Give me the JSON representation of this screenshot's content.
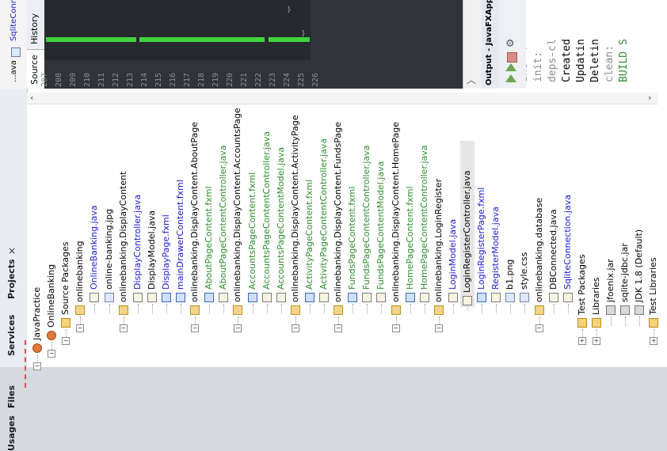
{
  "editor": {
    "tabs": [
      "History",
      "Source"
    ],
    "file_tab": "SqliteConn",
    "side_label": "...ava",
    "line_numbers": [
      "207",
      "208",
      "209",
      "210",
      "211",
      "212",
      "213",
      "214",
      "215",
      "216",
      "217",
      "218",
      "219",
      "220",
      "221",
      "222",
      "223",
      "224",
      "225",
      "226"
    ]
  },
  "output": {
    "title": "Output - JavaFXApp",
    "lines": [
      {
        "text": "ant -f",
        "color": "#8a8a8a"
      },
      {
        "text": "init:",
        "color": "#8a8a8a"
      },
      {
        "text": "deps-cl",
        "color": "#8a8a8a"
      },
      {
        "text": "Created",
        "color": "#000000"
      },
      {
        "text": "Updatin",
        "color": "#000000"
      },
      {
        "text": "Deletin",
        "color": "#000000"
      },
      {
        "text": "clean:",
        "color": "#8a8a8a"
      },
      {
        "text": "BUILD S",
        "color": "#2e8b2e"
      }
    ]
  },
  "side_tabs": {
    "usages": "Usages",
    "files": "Files",
    "services": "Services",
    "projects": "Projects",
    "close": "×"
  },
  "tree": [
    {
      "label": "JavaPractice",
      "icon": "coffee-cup-icon",
      "color": "#000000",
      "depth": 0
    },
    {
      "label": "OnlineBanking",
      "icon": "coffee-cup-icon",
      "color": "#000000",
      "depth": 1
    },
    {
      "label": "Source Packages",
      "icon": "folder-icon",
      "color": "#000000",
      "depth": 2
    },
    {
      "label": "onlinebanking",
      "icon": "package-icon",
      "color": "#000000",
      "depth": 3
    },
    {
      "label": "OnlineBanking.java",
      "icon": "java-file-icon",
      "color": "#1a1ad6",
      "depth": 4
    },
    {
      "label": "online-banking.jpg",
      "icon": "image-file-icon",
      "color": "#000000",
      "depth": 4
    },
    {
      "label": "onlinebanking.DisplayContent",
      "icon": "package-icon",
      "color": "#000000",
      "depth": 3
    },
    {
      "label": "DisplayController.java",
      "icon": "java-file-icon",
      "color": "#1a1ad6",
      "depth": 4
    },
    {
      "label": "DisplayModel.java",
      "icon": "java-file-icon",
      "color": "#000000",
      "depth": 4
    },
    {
      "label": "DisplayPage.fxml",
      "icon": "fxml-file-icon",
      "color": "#1a1ad6",
      "depth": 4
    },
    {
      "label": "mainDrawerContent.fxml",
      "icon": "fxml-file-icon",
      "color": "#1a1ad6",
      "depth": 4
    },
    {
      "label": "onlinebanking.DisplayContent.AboutPage",
      "icon": "package-icon",
      "color": "#000000",
      "depth": 3
    },
    {
      "label": "AboutPageContent.fxml",
      "icon": "fxml-file-icon",
      "color": "#2e8b2e",
      "depth": 4
    },
    {
      "label": "AboutPageContentController.java",
      "icon": "java-file-icon",
      "color": "#2e8b2e",
      "depth": 4
    },
    {
      "label": "onlinebanking.DisplayContent.AccountsPage",
      "icon": "package-icon",
      "color": "#000000",
      "depth": 3
    },
    {
      "label": "AccountsPageContent.fxml",
      "icon": "fxml-file-icon",
      "color": "#2e8b2e",
      "depth": 4
    },
    {
      "label": "AccountsPageContentController.java",
      "icon": "java-file-icon",
      "color": "#2e8b2e",
      "depth": 4
    },
    {
      "label": "AccountsPageContentModel.java",
      "icon": "java-file-icon",
      "color": "#2e8b2e",
      "depth": 4
    },
    {
      "label": "onlinebanking.DisplayContent.ActivityPage",
      "icon": "package-icon",
      "color": "#000000",
      "depth": 3
    },
    {
      "label": "ActivityPageContent.fxml",
      "icon": "fxml-file-icon",
      "color": "#2e8b2e",
      "depth": 4
    },
    {
      "label": "ActivityPageContentController.java",
      "icon": "java-file-icon",
      "color": "#2e8b2e",
      "depth": 4
    },
    {
      "label": "onlinebanking.DisplayContent.FundsPage",
      "icon": "package-icon",
      "color": "#000000",
      "depth": 3
    },
    {
      "label": "FundsPageContent.fxml",
      "icon": "fxml-file-icon",
      "color": "#2e8b2e",
      "depth": 4
    },
    {
      "label": "FundsPageContentController.java",
      "icon": "java-file-icon",
      "color": "#2e8b2e",
      "depth": 4
    },
    {
      "label": "FundsPageContentModel.java",
      "icon": "java-file-icon",
      "color": "#2e8b2e",
      "depth": 4
    },
    {
      "label": "onlinebanking.DisplayContent.HomePage",
      "icon": "package-icon",
      "color": "#000000",
      "depth": 3
    },
    {
      "label": "HomePageContent.fxml",
      "icon": "fxml-file-icon",
      "color": "#2e8b2e",
      "depth": 4
    },
    {
      "label": "HomePageContentController.java",
      "icon": "java-file-icon",
      "color": "#2e8b2e",
      "depth": 4
    },
    {
      "label": "onlinebanking.LoginRegister",
      "icon": "package-icon",
      "color": "#000000",
      "depth": 3
    },
    {
      "label": "LoginModel.java",
      "icon": "java-file-icon",
      "color": "#1a1ad6",
      "depth": 4
    },
    {
      "label": "LoginRegisterController.java",
      "icon": "java-file-icon",
      "color": "#000000",
      "depth": 4,
      "selected": true
    },
    {
      "label": "LoginRegisterPage.fxml",
      "icon": "fxml-file-icon",
      "color": "#1a1ad6",
      "depth": 4
    },
    {
      "label": "RegisterModel.java",
      "icon": "java-file-icon",
      "color": "#1a1ad6",
      "depth": 4
    },
    {
      "label": "b1.png",
      "icon": "image-file-icon",
      "color": "#000000",
      "depth": 4
    },
    {
      "label": "style.css",
      "icon": "css-file-icon",
      "color": "#000000",
      "depth": 4
    },
    {
      "label": "onlinebanking.database",
      "icon": "package-icon",
      "color": "#000000",
      "depth": 3
    },
    {
      "label": "DBConnected.java",
      "icon": "java-file-icon",
      "color": "#000000",
      "depth": 4
    },
    {
      "label": "SqliteConnection.java",
      "icon": "java-file-icon",
      "color": "#1a1ad6",
      "depth": 4
    },
    {
      "label": "Test Packages",
      "icon": "folder-icon",
      "color": "#000000",
      "depth": 2
    },
    {
      "label": "Libraries",
      "icon": "library-icon",
      "color": "#000000",
      "depth": 2
    },
    {
      "label": "jfoenix.jar",
      "icon": "jar-icon",
      "color": "#000000",
      "depth": 3
    },
    {
      "label": "sqlite-jdbc.jar",
      "icon": "jar-icon",
      "color": "#000000",
      "depth": 3
    },
    {
      "label": "JDK 1.8 (Default)",
      "icon": "jdk-icon",
      "color": "#000000",
      "depth": 3
    },
    {
      "label": "Test Libraries",
      "icon": "library-icon",
      "color": "#000000",
      "depth": 2
    }
  ]
}
